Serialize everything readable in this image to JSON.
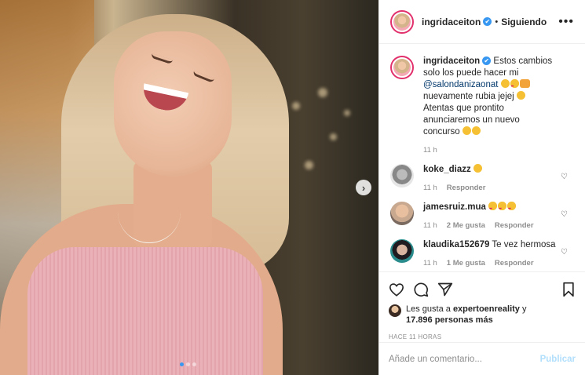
{
  "post": {
    "author": "ingridaceiton",
    "follow_status": "Siguiendo",
    "separator": "•",
    "more_label": "•••",
    "verified_mark": "✔",
    "caption": {
      "username": "ingridaceiton",
      "text_1": "Estos cambios solo los puede hacer mi",
      "mention": "@salondanizaonat",
      "text_2": "nuevamente rubia jejej",
      "text_3": "Atentas que prontito anunciaremos un nuevo concurso",
      "time": "11 h"
    },
    "comments": [
      {
        "username": "koke_diazz",
        "text": "",
        "time": "11 h",
        "likes": "",
        "reply": "Responder"
      },
      {
        "username": "jamesruiz.mua",
        "text": "",
        "time": "11 h",
        "likes": "2 Me gusta",
        "reply": "Responder"
      },
      {
        "username": "klaudika152679",
        "text": "Te vez hermosa",
        "time": "11 h",
        "likes": "1 Me gusta",
        "reply": "Responder"
      }
    ],
    "likes_line_1": "Les gusta a",
    "likes_user": "expertoenreality",
    "likes_and": "y",
    "likes_count": "17.896 personas más",
    "posted": "HACE 11 HORAS",
    "comment_placeholder": "Añade un comentario...",
    "publish_label": "Publicar",
    "next_icon": "chevron-right-icon",
    "carousel": {
      "count": 3,
      "active": 0
    }
  },
  "colors": {
    "accent": "#3897f0",
    "publish_disabled": "#b2dffc",
    "meta": "#8e8e8e"
  }
}
